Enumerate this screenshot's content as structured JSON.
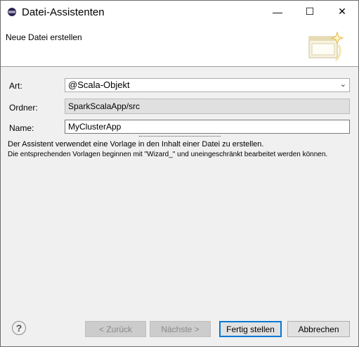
{
  "window": {
    "title": "Datei-Assistenten",
    "min_icon": "minimize-icon",
    "max_icon": "maximize-icon",
    "close_icon": "close-icon",
    "min_glyph": "—",
    "max_glyph": "☐",
    "close_glyph": "✕"
  },
  "banner": {
    "title": "Neue Datei erstellen",
    "graphic": "wizard-banner-icon"
  },
  "form": {
    "art_label": "Art:",
    "art_value": "@Scala-Objekt",
    "folder_label": "Ordner:",
    "folder_value": "SparkScalaApp/src",
    "name_label": "Name:",
    "name_value": "MyClusterApp"
  },
  "info": {
    "line1": "Der Assistent verwendet eine Vorlage in den Inhalt einer Datei zu erstellen.",
    "line2": "Die entsprechenden Vorlagen beginnen mit \"Wizard_\" und uneingeschränkt bearbeitet werden können."
  },
  "footer": {
    "help_glyph": "?",
    "back": "< Zurück",
    "next": "Nächste >",
    "finish": "Fertig stellen",
    "cancel": "Abbrechen"
  },
  "colors": {
    "focus_border": "#0078d7",
    "dialog_bg": "#f0f0f0"
  }
}
